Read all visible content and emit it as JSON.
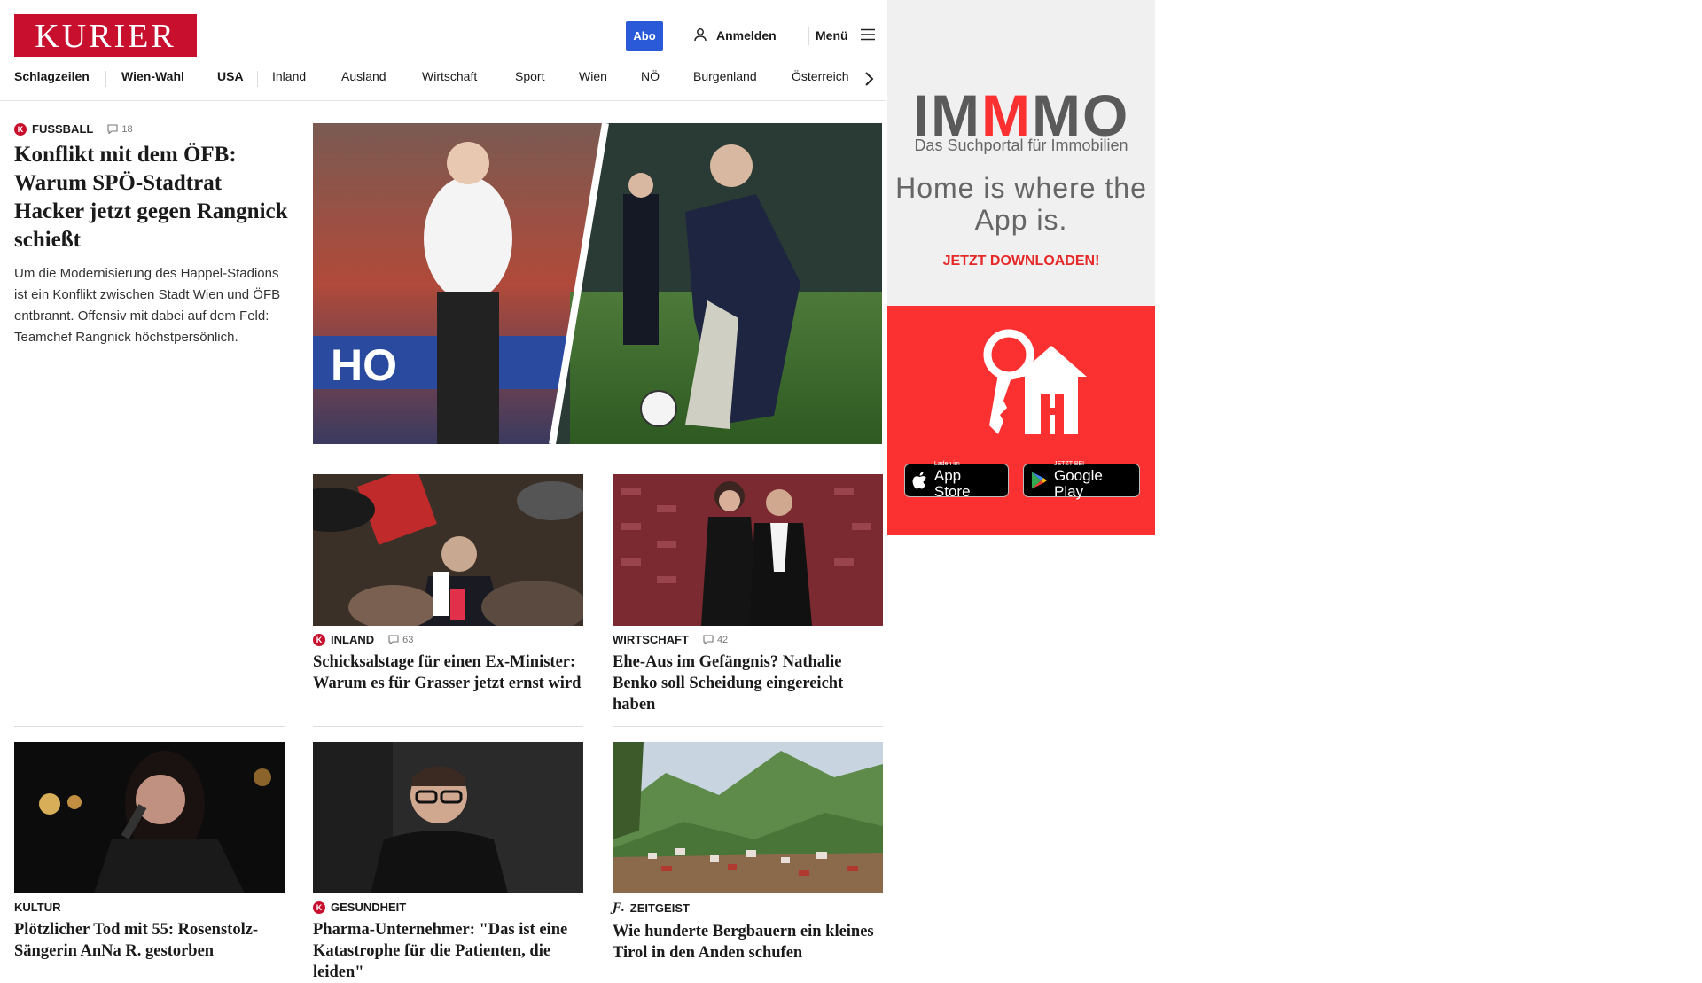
{
  "header": {
    "logo": "KURIER",
    "abo_label": "Abo",
    "login_label": "Anmelden",
    "menu_label": "Menü"
  },
  "nav": {
    "items": [
      "Schlagzeilen",
      "Wien-Wahl",
      "USA",
      "Inland",
      "Ausland",
      "Wirtschaft",
      "Sport",
      "Wien",
      "NÖ",
      "Burgenland",
      "Österreich"
    ]
  },
  "lead": {
    "kicker": "FUSSBALL",
    "comments": "18",
    "headline": "Konflikt mit dem ÖFB: Warum SPÖ-Stadtrat Hacker jetzt gegen Rangnick schießt",
    "teaser": "Um die Modernisierung des Happel-Stadions ist ein Konflikt zwischen Stadt Wien und ÖFB entbrannt. Offensiv mit dabei auf dem Feld: Teamchef Rangnick höchstpersönlich."
  },
  "articles": [
    {
      "kicker": "INLAND",
      "comments": "63",
      "headline": "Schicksalstage für einen Ex-Minister: Warum es für Grasser jetzt ernst wird"
    },
    {
      "kicker": "WIRTSCHAFT",
      "comments": "42",
      "headline": "Ehe-Aus im Gefängnis? Nathalie Benko soll Scheidung eingereicht haben"
    },
    {
      "kicker": "KULTUR",
      "headline": "Plötzlicher Tod mit 55: Rosenstolz-Sängerin AnNa R. gestorben"
    },
    {
      "kicker": "GESUNDHEIT",
      "headline": "Pharma-Unternehmer: \"Das ist eine Katastrophe für die Patienten, die leiden\""
    },
    {
      "kicker": "ZEITGEIST",
      "headline": "Wie hunderte Bergbauern ein kleines Tirol in den Anden schufen"
    }
  ],
  "ad": {
    "brand_pre": "IM",
    "brand_mid": "M",
    "brand_post": "MO",
    "subtitle": "Das Suchportal für Immobilien",
    "tagline": "Home is where the App is.",
    "cta": "JETZT DOWNLOADEN!",
    "appstore_small": "Laden im",
    "appstore_big": "App Store",
    "play_small": "JETZT BEI",
    "play_big": "Google Play"
  },
  "colors": {
    "brand_red": "#c8102e",
    "abo_blue": "#2a5ad8",
    "ad_red": "#fb3030"
  }
}
